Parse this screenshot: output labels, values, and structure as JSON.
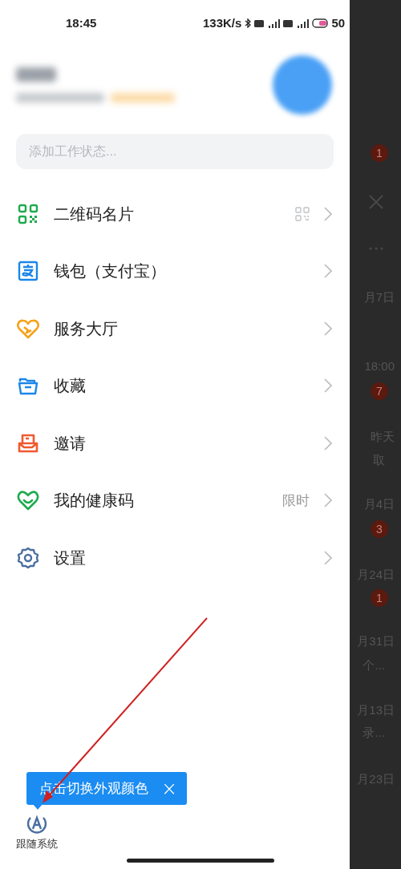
{
  "status_bar": {
    "time": "18:45",
    "speed": "133K/s",
    "battery": "50"
  },
  "status_input": {
    "placeholder": "添加工作状态..."
  },
  "menu": [
    {
      "kind": "qr",
      "label": "二维码名片",
      "shortcut_icon": true
    },
    {
      "kind": "wallet",
      "label": "钱包（支付宝）"
    },
    {
      "kind": "service",
      "label": "服务大厅"
    },
    {
      "kind": "favorites",
      "label": "收藏"
    },
    {
      "kind": "invite",
      "label": "邀请"
    },
    {
      "kind": "health",
      "label": "我的健康码",
      "extra": "限时"
    },
    {
      "kind": "settings",
      "label": "设置"
    }
  ],
  "tooltip": {
    "text": "点击切换外观颜色",
    "close": "×"
  },
  "theme_button": {
    "label": "跟随系统"
  },
  "background_list": [
    {
      "kind": "badge",
      "text": "1"
    },
    {
      "kind": "close"
    },
    {
      "kind": "more"
    },
    {
      "kind": "date",
      "text": "月7日"
    },
    {
      "kind": "date",
      "text": "18:00"
    },
    {
      "kind": "badge",
      "text": "7"
    },
    {
      "kind": "date",
      "text": "昨天"
    },
    {
      "kind": "snippet",
      "text": "取"
    },
    {
      "kind": "date",
      "text": "月4日"
    },
    {
      "kind": "badge",
      "text": "3"
    },
    {
      "kind": "date",
      "text": "月24日"
    },
    {
      "kind": "badge",
      "text": "1"
    },
    {
      "kind": "date",
      "text": "月31日"
    },
    {
      "kind": "snippet",
      "text": "个..."
    },
    {
      "kind": "date",
      "text": "月13日"
    },
    {
      "kind": "snippet",
      "text": "录..."
    },
    {
      "kind": "date",
      "text": "月23日"
    }
  ]
}
